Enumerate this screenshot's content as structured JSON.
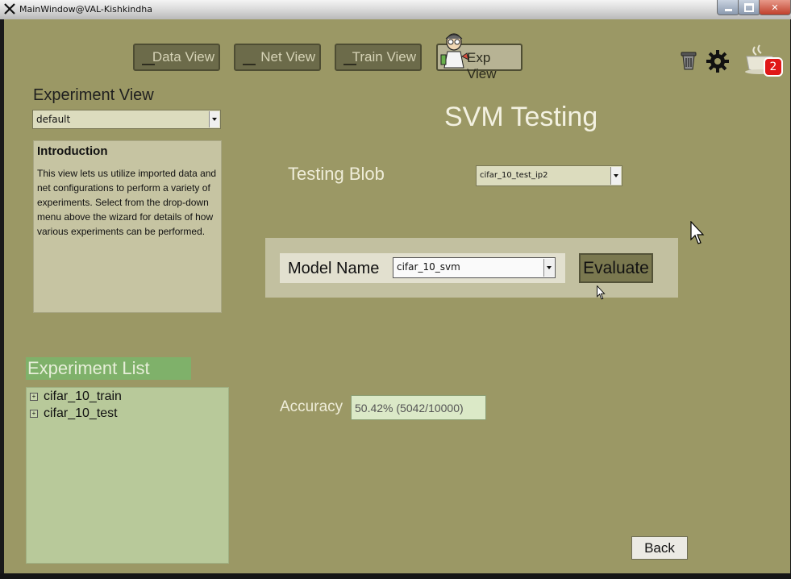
{
  "window": {
    "title": "MainWindow@VAL-Kishkindha",
    "close_glyph": "✕"
  },
  "nav": {
    "data_view": "Data View",
    "net_view": "Net View",
    "train_view": "Train View",
    "exp_view": "Exp View"
  },
  "toolbar": {
    "notification_count": "2",
    "icons": [
      "trash-icon",
      "gear-icon",
      "coffee-cup-icon"
    ]
  },
  "left": {
    "experiment_view_label": "Experiment View",
    "experiment_select_value": "default",
    "intro_title": "Introduction",
    "intro_text": "This view lets us utilize imported data and net configurations to perform a variety of experiments. Select from the drop-down menu above the wizard for details of how various experiments can be performed.",
    "experiment_list_label": "Experiment List",
    "experiments": [
      "cifar_10_train",
      "cifar_10_test"
    ],
    "expander_glyph": "+"
  },
  "main": {
    "title": "SVM Testing",
    "testing_blob_label": "Testing Blob",
    "testing_blob_value": "cifar_10_test_ip2",
    "model_name_label": "Model Name",
    "model_name_value": "cifar_10_svm",
    "evaluate_label": "Evaluate",
    "accuracy_label": "Accuracy",
    "accuracy_value": "50.42% (5042/10000)",
    "back_label": "Back"
  },
  "colors": {
    "background": "#9b9865",
    "list_header": "#7fb16a",
    "badge": "#e01818"
  }
}
